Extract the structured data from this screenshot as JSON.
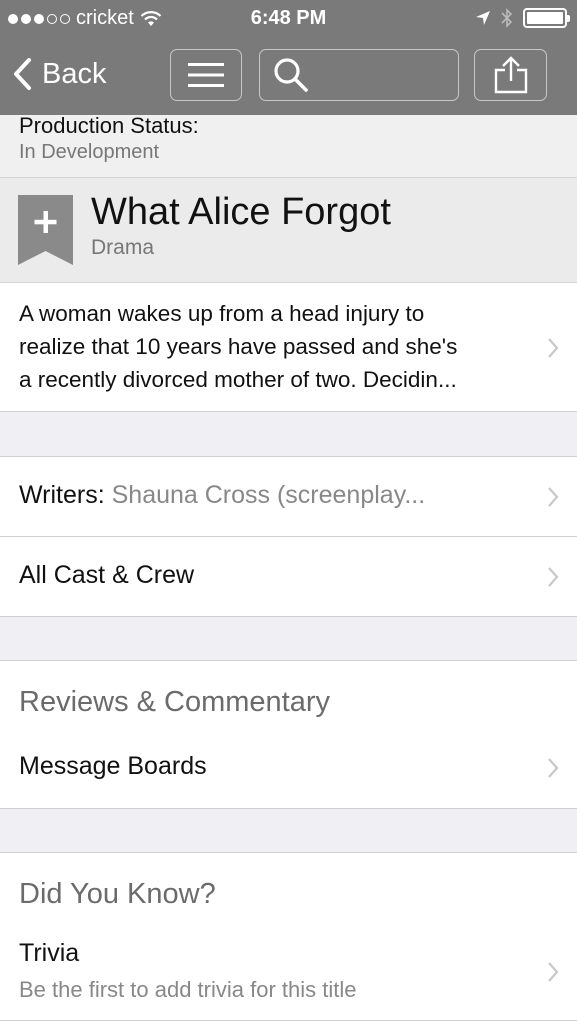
{
  "status_bar": {
    "carrier": "cricket",
    "time": "6:48 PM",
    "signal_dots_filled": 3,
    "signal_dots_total": 5
  },
  "nav": {
    "back_label": "Back"
  },
  "production": {
    "label": "Production Status:",
    "value": "In Development"
  },
  "title_block": {
    "title": "What Alice Forgot",
    "genre": "Drama"
  },
  "plot": {
    "line1": "A woman wakes up from a head injury to",
    "line2": "realize that 10 years have passed and she's",
    "line3": "a recently divorced mother of two. Decidin..."
  },
  "writers": {
    "label": "Writers:",
    "value": "Shauna Cross (screenplay..."
  },
  "cast_crew": {
    "label": "All Cast & Crew"
  },
  "reviews": {
    "heading": "Reviews & Commentary",
    "message_boards": "Message Boards"
  },
  "did_you_know": {
    "heading": "Did You Know?",
    "trivia_label": "Trivia",
    "trivia_sub": "Be the first to add trivia for this title"
  },
  "colors": {
    "nav_bg": "#7a7a7a",
    "page_bg": "#efeff4",
    "muted_text": "#888888"
  }
}
